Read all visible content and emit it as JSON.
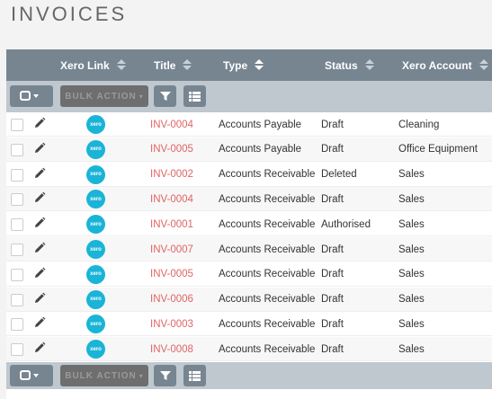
{
  "page": {
    "title": "INVOICES"
  },
  "columns": {
    "xero_link": "Xero Link",
    "title": "Title",
    "type": "Type",
    "status": "Status",
    "xero_account": "Xero Account"
  },
  "toolbar": {
    "bulk_action_label": "BULK ACTION"
  },
  "xero_icon_label": "xero",
  "rows": [
    {
      "title": "INV-0004",
      "type": "Accounts Payable",
      "status": "Draft",
      "account": "Cleaning"
    },
    {
      "title": "INV-0005",
      "type": "Accounts Payable",
      "status": "Draft",
      "account": "Office Equipment"
    },
    {
      "title": "INV-0002",
      "type": "Accounts Receivable",
      "status": "Deleted",
      "account": "Sales"
    },
    {
      "title": "INV-0004",
      "type": "Accounts Receivable",
      "status": "Draft",
      "account": "Sales"
    },
    {
      "title": "INV-0001",
      "type": "Accounts Receivable",
      "status": "Authorised",
      "account": "Sales"
    },
    {
      "title": "INV-0007",
      "type": "Accounts Receivable",
      "status": "Draft",
      "account": "Sales"
    },
    {
      "title": "INV-0005",
      "type": "Accounts Receivable",
      "status": "Draft",
      "account": "Sales"
    },
    {
      "title": "INV-0006",
      "type": "Accounts Receivable",
      "status": "Draft",
      "account": "Sales"
    },
    {
      "title": "INV-0003",
      "type": "Accounts Receivable",
      "status": "Draft",
      "account": "Sales"
    },
    {
      "title": "INV-0008",
      "type": "Accounts Receivable",
      "status": "Draft",
      "account": "Sales"
    }
  ],
  "icons": {
    "edit": "pencil-icon",
    "xero": "xero-logo-icon",
    "sort": "sort-icon",
    "filter": "filter-icon",
    "columns": "columns-icon",
    "select": "checkbox-dropdown-icon"
  },
  "colors": {
    "header_bg": "#778591",
    "toolbar_bg": "#bfc8cf",
    "link": "#e06565",
    "xero_blue": "#1ab4d7"
  }
}
